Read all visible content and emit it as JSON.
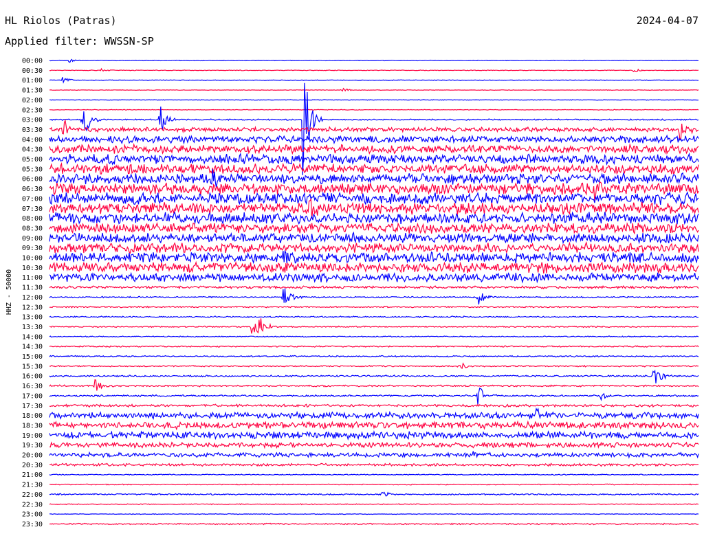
{
  "header": {
    "station": "HL Riolos (Patras)",
    "filter": "Applied filter: WWSSN-SP",
    "date": "2024-04-07"
  },
  "chart_data": {
    "type": "line",
    "title": "HL Riolos (Patras)",
    "subtitle": "Applied filter: WWSSN-SP",
    "ylabel": "HHZ - 50000",
    "grid": false,
    "colors": [
      "#0000ff",
      "#ff0040"
    ],
    "rows": [
      {
        "label": "00:00",
        "level": 0.4
      },
      {
        "label": "00:30",
        "level": 0.35
      },
      {
        "label": "01:00",
        "level": 0.4
      },
      {
        "label": "01:30",
        "level": 0.3
      },
      {
        "label": "02:00",
        "level": 0.35
      },
      {
        "label": "02:30",
        "level": 0.35
      },
      {
        "label": "03:00",
        "level": 0.8
      },
      {
        "label": "03:30",
        "level": 2.5
      },
      {
        "label": "04:00",
        "level": 4.0
      },
      {
        "label": "04:30",
        "level": 5.0
      },
      {
        "label": "05:00",
        "level": 5.5
      },
      {
        "label": "05:30",
        "level": 5.5
      },
      {
        "label": "06:00",
        "level": 6.0
      },
      {
        "label": "06:30",
        "level": 6.5
      },
      {
        "label": "07:00",
        "level": 6.5
      },
      {
        "label": "07:30",
        "level": 6.5
      },
      {
        "label": "08:00",
        "level": 6.5
      },
      {
        "label": "08:30",
        "level": 6.0
      },
      {
        "label": "09:00",
        "level": 5.5
      },
      {
        "label": "09:30",
        "level": 5.5
      },
      {
        "label": "10:00",
        "level": 6.0
      },
      {
        "label": "10:30",
        "level": 6.0
      },
      {
        "label": "11:00",
        "level": 5.0
      },
      {
        "label": "11:30",
        "level": 1.5
      },
      {
        "label": "12:00",
        "level": 0.8
      },
      {
        "label": "12:30",
        "level": 0.8
      },
      {
        "label": "13:00",
        "level": 0.8
      },
      {
        "label": "13:30",
        "level": 0.8
      },
      {
        "label": "14:00",
        "level": 0.6
      },
      {
        "label": "14:30",
        "level": 0.8
      },
      {
        "label": "15:00",
        "level": 0.8
      },
      {
        "label": "15:30",
        "level": 0.8
      },
      {
        "label": "16:00",
        "level": 1.0
      },
      {
        "label": "16:30",
        "level": 1.0
      },
      {
        "label": "17:00",
        "level": 1.0
      },
      {
        "label": "17:30",
        "level": 1.5
      },
      {
        "label": "18:00",
        "level": 3.5
      },
      {
        "label": "18:30",
        "level": 4.0
      },
      {
        "label": "19:00",
        "level": 4.0
      },
      {
        "label": "19:30",
        "level": 3.0
      },
      {
        "label": "20:00",
        "level": 2.5
      },
      {
        "label": "20:30",
        "level": 1.5
      },
      {
        "label": "21:00",
        "level": 0.6
      },
      {
        "label": "21:30",
        "level": 0.6
      },
      {
        "label": "22:00",
        "level": 0.8
      },
      {
        "label": "22:30",
        "level": 0.5
      },
      {
        "label": "23:00",
        "level": 0.4
      },
      {
        "label": "23:30",
        "level": 0.8
      }
    ],
    "events": [
      {
        "row": 0,
        "t": 0.03,
        "amp": 4,
        "color": "#0000ff"
      },
      {
        "row": 1,
        "t": 0.08,
        "amp": 4,
        "color": "#ff0040"
      },
      {
        "row": 1,
        "t": 0.9,
        "amp": 4,
        "color": "#ff0040"
      },
      {
        "row": 2,
        "t": 0.02,
        "amp": 6,
        "color": "#0000ff"
      },
      {
        "row": 3,
        "t": 0.45,
        "amp": 4,
        "color": "#ff0040"
      },
      {
        "row": 6,
        "t": 0.39,
        "amp": 95,
        "color": "#ff0040"
      },
      {
        "row": 6,
        "t": 0.05,
        "amp": 40,
        "color": "#0000ff"
      },
      {
        "row": 6,
        "t": 0.17,
        "amp": 25,
        "color": "#0000ff"
      },
      {
        "row": 7,
        "t": 0.02,
        "amp": 20,
        "color": "#ff0040"
      },
      {
        "row": 7,
        "t": 0.97,
        "amp": 25,
        "color": "#ff0040"
      },
      {
        "row": 12,
        "t": 0.13,
        "amp": 18,
        "color": "#0000ff"
      },
      {
        "row": 12,
        "t": 0.25,
        "amp": 20,
        "color": "#0000ff"
      },
      {
        "row": 13,
        "t": 0.84,
        "amp": 22,
        "color": "#ff0040"
      },
      {
        "row": 15,
        "t": 0.4,
        "amp": 25,
        "color": "#ff0040"
      },
      {
        "row": 20,
        "t": 0.36,
        "amp": 18,
        "color": "#0000ff"
      },
      {
        "row": 24,
        "t": 0.36,
        "amp": 22,
        "color": "#0000ff"
      },
      {
        "row": 24,
        "t": 0.66,
        "amp": 14,
        "color": "#0000ff"
      },
      {
        "row": 27,
        "t": 0.31,
        "amp": 18,
        "color": "#ff0040"
      },
      {
        "row": 27,
        "t": 0.32,
        "amp": 30,
        "color": "#ff0040"
      },
      {
        "row": 31,
        "t": 0.63,
        "amp": 10,
        "color": "#0000ff"
      },
      {
        "row": 32,
        "t": 0.93,
        "amp": 22,
        "color": "#0000ff"
      },
      {
        "row": 33,
        "t": 0.07,
        "amp": 12,
        "color": "#ff0040"
      },
      {
        "row": 34,
        "t": 0.66,
        "amp": 18,
        "color": "#0000ff"
      },
      {
        "row": 34,
        "t": 0.85,
        "amp": 12,
        "color": "#0000ff"
      },
      {
        "row": 36,
        "t": 0.75,
        "amp": 12,
        "color": "#0000ff"
      },
      {
        "row": 40,
        "t": 0.65,
        "amp": 10,
        "color": "#0000ff"
      },
      {
        "row": 44,
        "t": 0.51,
        "amp": 8,
        "color": "#0000ff"
      }
    ]
  }
}
